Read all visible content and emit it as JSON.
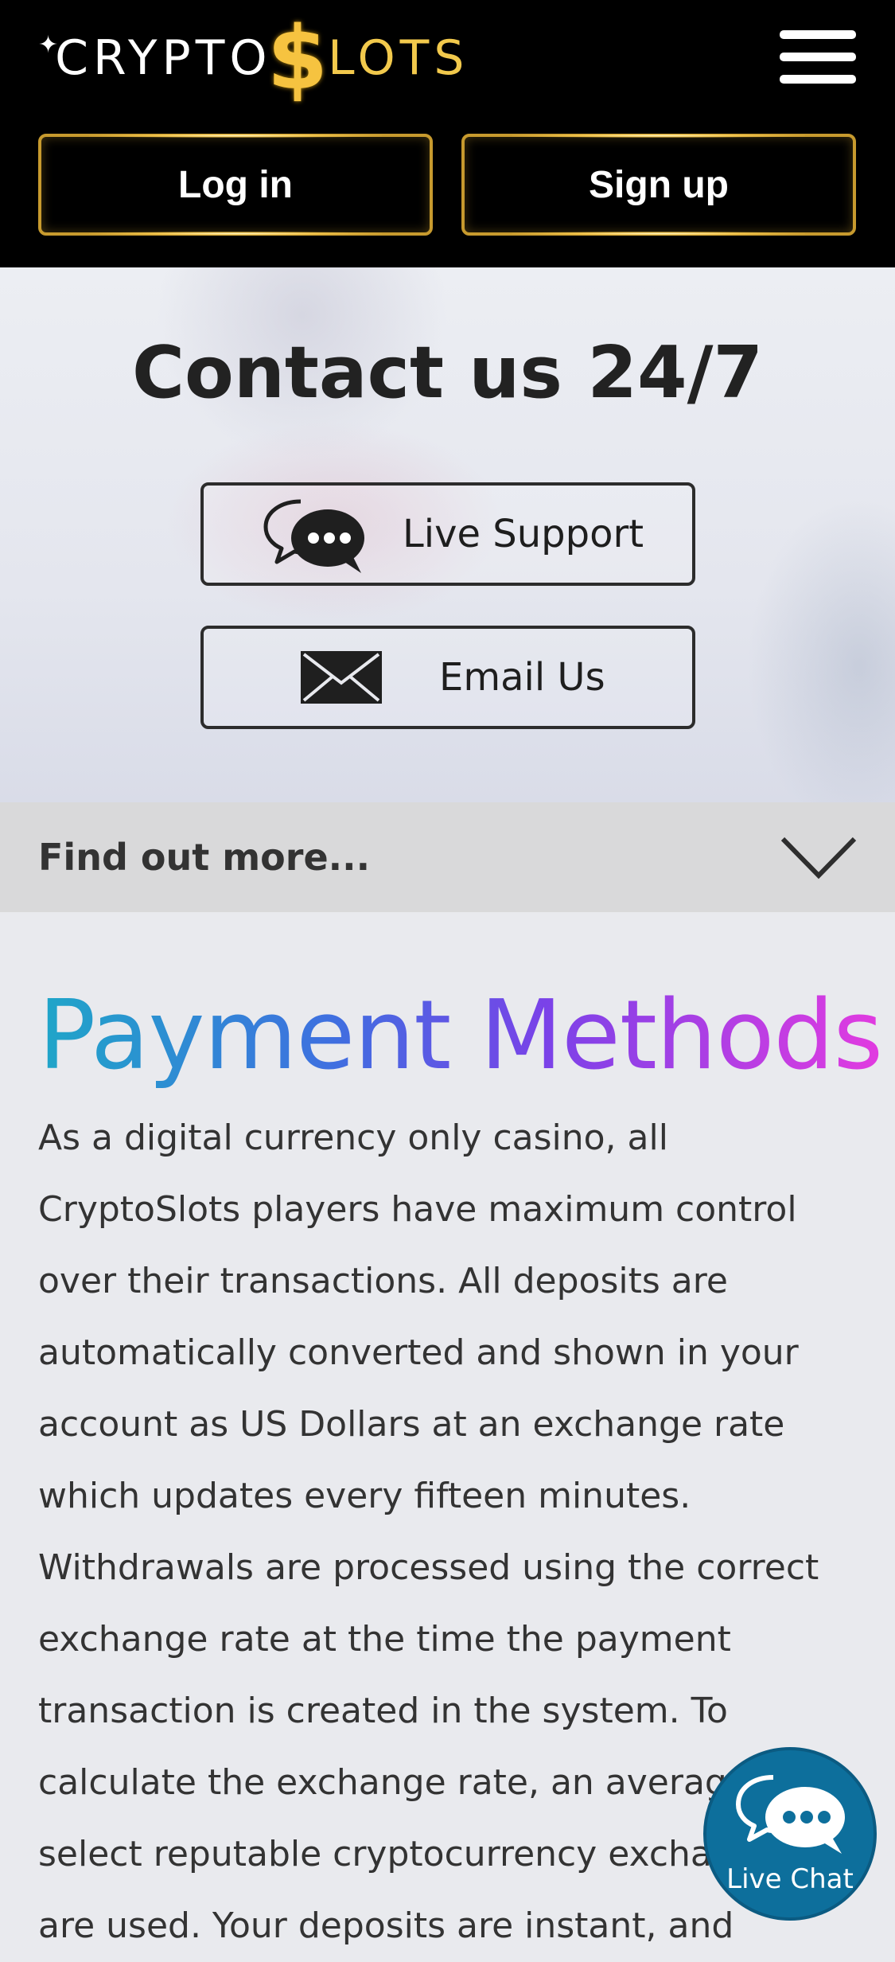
{
  "header": {
    "logo_prefix": "CRYPTO",
    "logo_symbol": "$",
    "logo_suffix": "LOTS",
    "menu_icon": "hamburger-menu-icon",
    "login_label": "Log in",
    "signup_label": "Sign up",
    "accent_color": "#c79a2e"
  },
  "hero": {
    "title": "Contact us 24/7",
    "live_support": {
      "label": "Live Support",
      "icon": "chat-bubbles-icon"
    },
    "email_us": {
      "label": "Email Us",
      "icon": "envelope-icon"
    }
  },
  "find_more": {
    "label": "Find out more...",
    "icon": "chevron-down-icon"
  },
  "payment": {
    "title": "Payment Methods",
    "body": "As a digital currency only casino, all CryptoSlots players have maximum control over their transactions. All deposits are automatically converted and shown in your account as US Dollars at an exchange rate which updates every fifteen minutes. Withdrawals are processed using the correct exchange rate at the time the payment transaction is created in the system. To calculate the exchange rate, an average of select reputable cryptocurrency exchanges are used. Your deposits are instant, and"
  },
  "live_chat": {
    "label": "Live Chat",
    "icon": "chat-bubbles-icon",
    "color": "#0d6f9c"
  }
}
